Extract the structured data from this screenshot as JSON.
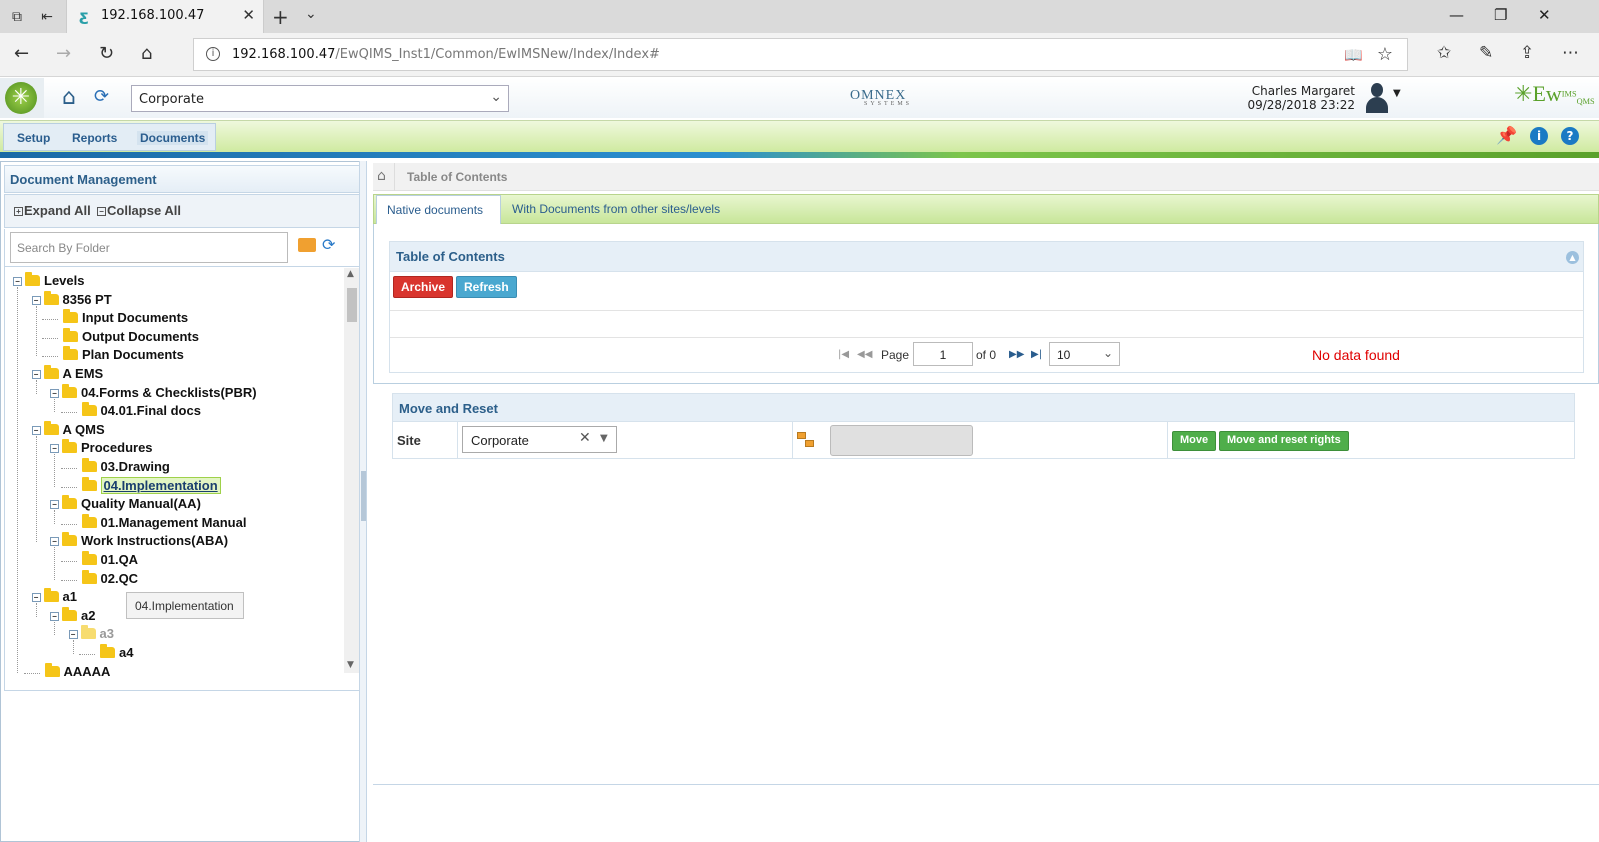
{
  "browser": {
    "tab_title": "192.168.100.47",
    "url_host": "192.168.100.47",
    "url_path": "/EwQIMS_Inst1/Common/EwIMSNew/Index/Index#"
  },
  "header": {
    "site_select": "Corporate",
    "omnex_logo": "OMNEX",
    "omnex_sub": "SYSTEMS",
    "user_name": "Charles Margaret",
    "datetime": "09/28/2018 23:22",
    "product_logo": "Ew",
    "product_logo_sup": "IMS",
    "product_logo_sub": "QMS"
  },
  "menu": {
    "items": [
      "Setup",
      "Reports",
      "Documents"
    ],
    "active": "Documents"
  },
  "left_panel": {
    "title": "Document Management",
    "expand_all": "Expand All",
    "collapse_all": "Collapse All",
    "search_placeholder": "Search By Folder",
    "tooltip": "04.Implementation",
    "tree": [
      {
        "label": "Levels",
        "depth": 0,
        "toggle": "−"
      },
      {
        "label": "8356 PT",
        "depth": 1,
        "toggle": "−"
      },
      {
        "label": "Input Documents",
        "depth": 2
      },
      {
        "label": "Output Documents",
        "depth": 2
      },
      {
        "label": "Plan Documents",
        "depth": 2
      },
      {
        "label": "A EMS",
        "depth": 1,
        "toggle": "−"
      },
      {
        "label": "04.Forms & Checklists(PBR)",
        "depth": 2,
        "toggle": "−"
      },
      {
        "label": "04.01.Final docs",
        "depth": 3
      },
      {
        "label": "A QMS",
        "depth": 1,
        "toggle": "−"
      },
      {
        "label": "Procedures",
        "depth": 2,
        "toggle": "−"
      },
      {
        "label": "03.Drawing",
        "depth": 3
      },
      {
        "label": "04.Implementation",
        "depth": 3,
        "selected": true
      },
      {
        "label": "Quality Manual(AA)",
        "depth": 2,
        "toggle": "−"
      },
      {
        "label": "01.Management Manual",
        "depth": 3
      },
      {
        "label": "Work Instructions(ABA)",
        "depth": 2,
        "toggle": "−"
      },
      {
        "label": "01.QA",
        "depth": 3
      },
      {
        "label": "02.QC",
        "depth": 3
      },
      {
        "label": "a1",
        "depth": 1,
        "toggle": "−"
      },
      {
        "label": "a2",
        "depth": 2,
        "toggle": "−"
      },
      {
        "label": "a3",
        "depth": 3,
        "toggle": "−",
        "dim": true
      },
      {
        "label": "a4",
        "depth": 4
      },
      {
        "label": "AAAAA",
        "depth": 1
      }
    ]
  },
  "right_panel": {
    "breadcrumb": "Table of Contents",
    "tabs": [
      "Native documents",
      "With Documents from other sites/levels"
    ],
    "active_tab": "Native documents",
    "toc_title": "Table of Contents",
    "archive_button": "Archive",
    "refresh_button": "Refresh",
    "pager": {
      "page_label": "Page",
      "page_value": "1",
      "of_label": "of 0",
      "page_size": "10"
    },
    "no_data": "No data found",
    "move_title": "Move and Reset",
    "site_label": "Site",
    "site_value": "Corporate",
    "move_button": "Move",
    "move_reset_button": "Move and reset rights"
  }
}
